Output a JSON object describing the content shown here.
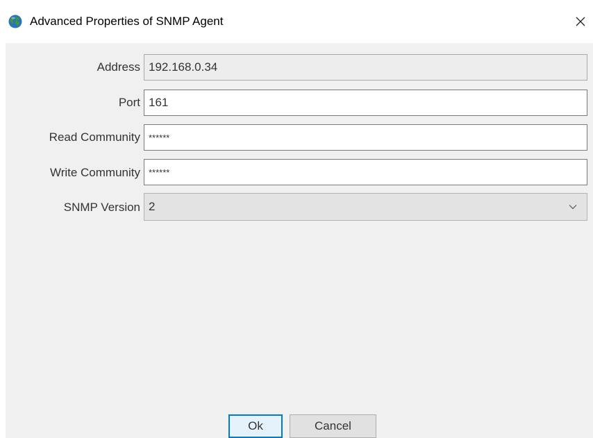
{
  "window": {
    "title": "Advanced Properties of SNMP Agent",
    "icon": "globe-icon",
    "close_glyph": "✕"
  },
  "form": {
    "address": {
      "label": "Address",
      "value": "192.168.0.34",
      "readonly": true
    },
    "port": {
      "label": "Port",
      "value": "161"
    },
    "read_community": {
      "label": "Read Community",
      "value": "******"
    },
    "write_community": {
      "label": "Write Community",
      "value": "******"
    },
    "snmp_version": {
      "label": "SNMP Version",
      "value": "2"
    }
  },
  "buttons": {
    "ok_label": "Ok",
    "cancel_label": "Cancel"
  },
  "colors": {
    "focus_accent": "#0078d7",
    "client_bg": "#f0f0f0"
  }
}
